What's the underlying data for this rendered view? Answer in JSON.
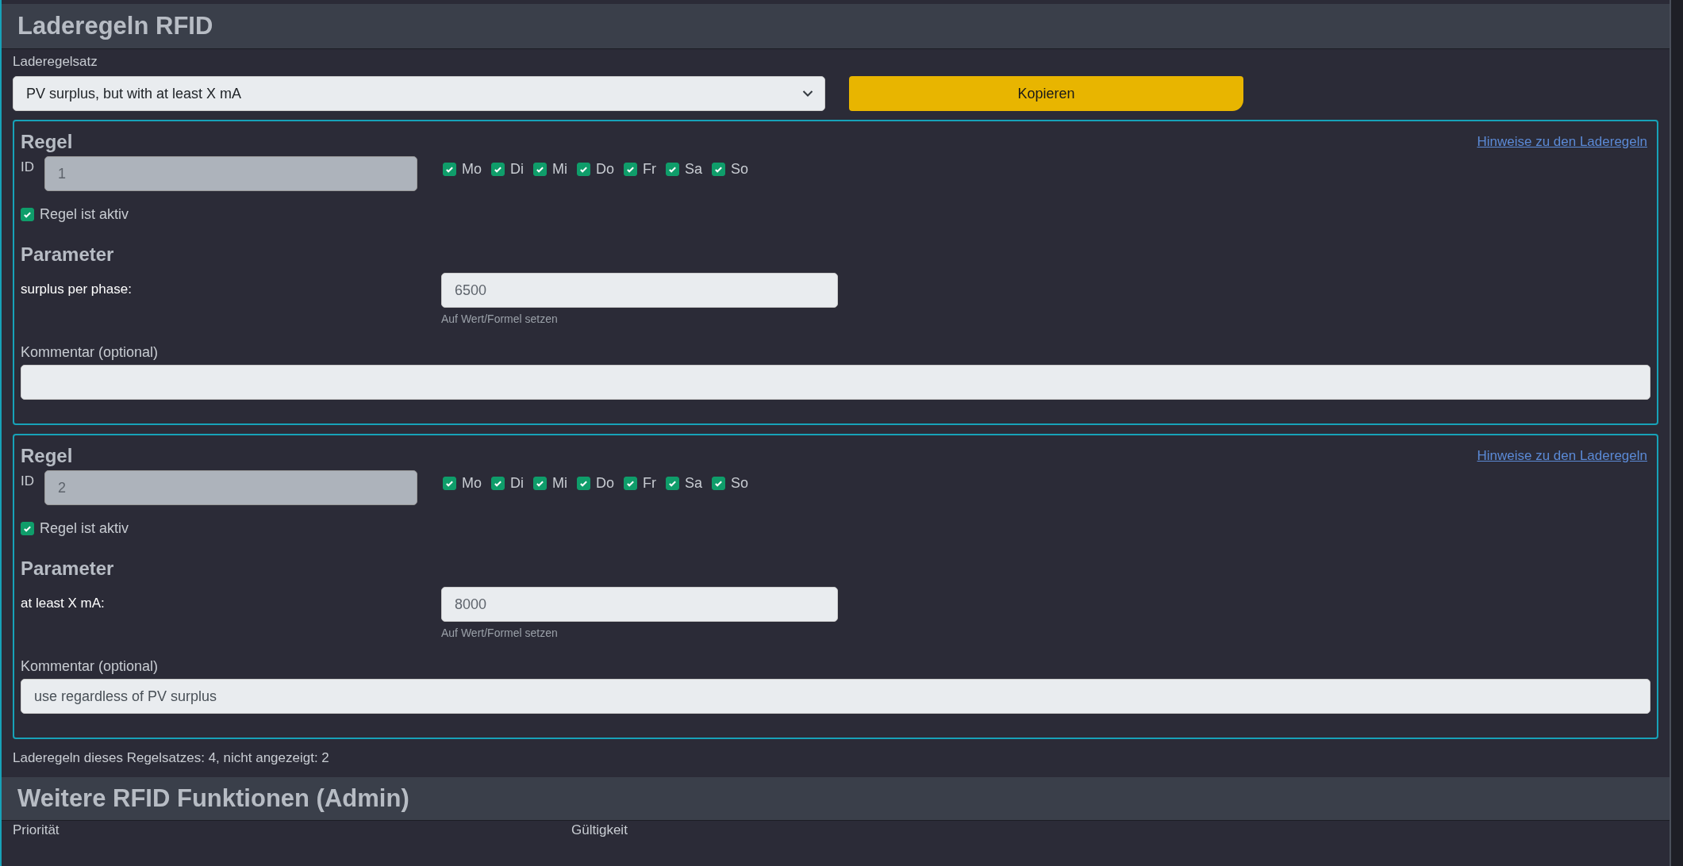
{
  "header": {
    "title": "Laderegeln RFID"
  },
  "ruleset": {
    "label": "Laderegelsatz",
    "value": "PV surplus, but with at least X mA",
    "copy_button": "Kopieren"
  },
  "rules": [
    {
      "heading": "Regel",
      "hint_link": "Hinweise zu den Laderegeln",
      "id_label": "ID",
      "id": "1",
      "days": [
        {
          "label": "Mo",
          "checked": true
        },
        {
          "label": "Di",
          "checked": true
        },
        {
          "label": "Mi",
          "checked": true
        },
        {
          "label": "Do",
          "checked": true
        },
        {
          "label": "Fr",
          "checked": true
        },
        {
          "label": "Sa",
          "checked": true
        },
        {
          "label": "So",
          "checked": true
        }
      ],
      "active": {
        "label": "Regel ist aktiv",
        "checked": true
      },
      "params_heading": "Parameter",
      "params": [
        {
          "label": "surplus per phase:",
          "value": "6500",
          "hint": "Auf Wert/Formel setzen"
        }
      ],
      "comment_label": "Kommentar (optional)"
    },
    {
      "heading": "Regel",
      "hint_link": "Hinweise zu den Laderegeln",
      "id_label": "ID",
      "id": "2",
      "days": [
        {
          "label": "Mo",
          "checked": true
        },
        {
          "label": "Di",
          "checked": true
        },
        {
          "label": "Mi",
          "checked": true
        },
        {
          "label": "Do",
          "checked": true
        },
        {
          "label": "Fr",
          "checked": true
        },
        {
          "label": "Sa",
          "checked": true
        },
        {
          "label": "So",
          "checked": true
        }
      ],
      "active": {
        "label": "Regel ist aktiv",
        "checked": true
      },
      "params_heading": "Parameter",
      "params": [
        {
          "label": "at least X mA:",
          "value": "8000",
          "hint": "Auf Wert/Formel setzen"
        }
      ],
      "comment_label": "Kommentar (optional)",
      "comment": "use regardless of PV surplus"
    }
  ],
  "summary": "Laderegeln dieses Regelsatzes: 4, nicht angezeigt: 2",
  "admin": {
    "title": "Weitere RFID Funktionen (Admin)",
    "columns": [
      "Priorität",
      "Gültigkeit"
    ]
  }
}
